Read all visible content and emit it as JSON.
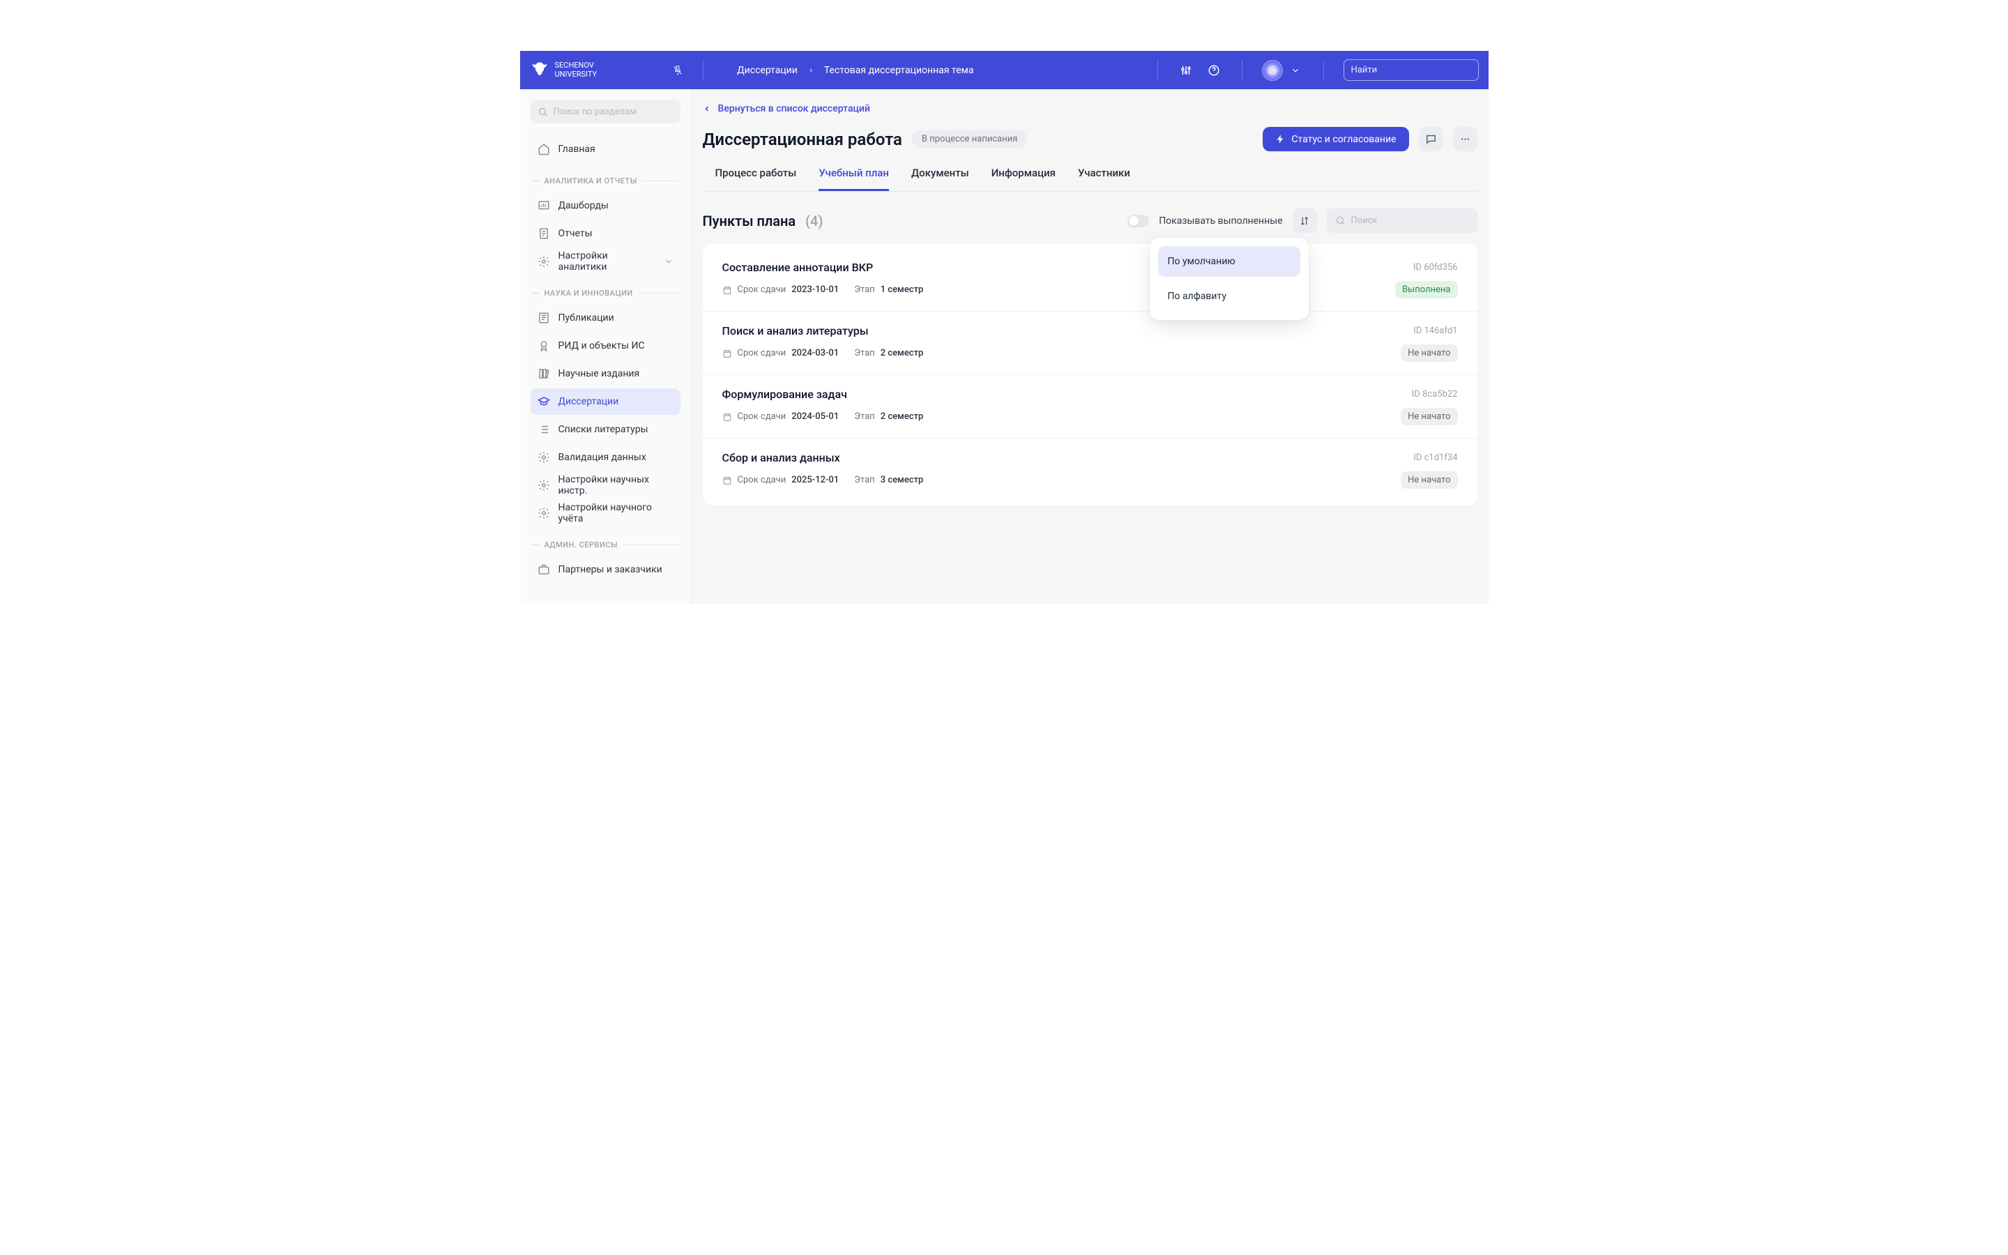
{
  "brand": {
    "line1": "SECHENOV",
    "line2": "UNIVERSITY"
  },
  "header": {
    "breadcrumb": [
      "Диссертации",
      "Тестовая диссертационная тема"
    ],
    "search_placeholder": "Найти"
  },
  "sidebar": {
    "search_placeholder": "Поиск по разделам",
    "home": "Главная",
    "sections": [
      {
        "title": "АНАЛИТИКА И ОТЧЕТЫ",
        "items": [
          {
            "label": "Дашборды",
            "icon": "dashboard"
          },
          {
            "label": "Отчеты",
            "icon": "report"
          },
          {
            "label": "Настройки аналитики",
            "icon": "gear",
            "collapsible": true
          }
        ]
      },
      {
        "title": "НАУКА И ИННОВАЦИИ",
        "items": [
          {
            "label": "Публикации",
            "icon": "publication"
          },
          {
            "label": "РИД и объекты ИС",
            "icon": "award"
          },
          {
            "label": "Научные издания",
            "icon": "books"
          },
          {
            "label": "Диссертации",
            "icon": "graduation",
            "active": true
          },
          {
            "label": "Списки литературы",
            "icon": "list"
          },
          {
            "label": "Валидация данных",
            "icon": "gear"
          },
          {
            "label": "Настройки научных инстр.",
            "icon": "gear"
          },
          {
            "label": "Настройки научного учёта",
            "icon": "gear"
          }
        ]
      },
      {
        "title": "АДМИН. СЕРВИСЫ",
        "items": [
          {
            "label": "Партнеры и заказчики",
            "icon": "briefcase"
          }
        ]
      }
    ]
  },
  "main": {
    "back_label": "Вернуться в список диссертаций",
    "title": "Диссертационная работа",
    "status_badge": "В процессе написания",
    "action_button": "Статус и согласование",
    "tabs": [
      "Процесс работы",
      "Учебный план",
      "Документы",
      "Информация",
      "Участники"
    ],
    "active_tab": 1,
    "list": {
      "title": "Пункты плана",
      "count": "(4)",
      "toggle_label": "Показывать выполненные",
      "search_placeholder": "Поиск",
      "sort_options": [
        "По умолчанию",
        "По алфавиту"
      ],
      "due_label": "Срок сдачи",
      "stage_label": "Этап",
      "id_prefix": "ID",
      "items": [
        {
          "name": "Составление аннотации ВКР",
          "due": "2023-10-01",
          "stage": "1 семестр",
          "id": "60fd356",
          "status": "Выполнена",
          "status_kind": "done"
        },
        {
          "name": "Поиск и анализ литературы",
          "due": "2024-03-01",
          "stage": "2 семестр",
          "id": "146afd1",
          "status": "Не начато",
          "status_kind": "not"
        },
        {
          "name": "Формулирование задач",
          "due": "2024-05-01",
          "stage": "2 семестр",
          "id": "8ca5b22",
          "status": "Не начато",
          "status_kind": "not"
        },
        {
          "name": "Сбор и анализ данных",
          "due": "2025-12-01",
          "stage": "3 семестр",
          "id": "c1d1f34",
          "status": "Не начато",
          "status_kind": "not"
        }
      ]
    }
  }
}
